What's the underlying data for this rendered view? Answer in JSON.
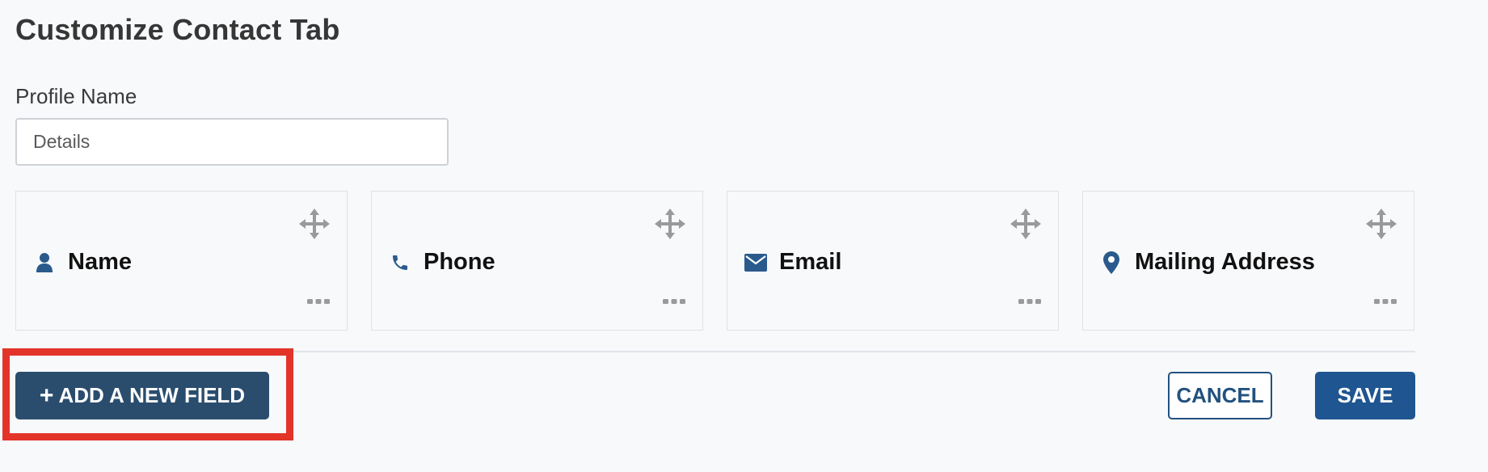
{
  "page": {
    "title": "Customize Contact Tab"
  },
  "profile": {
    "label": "Profile Name",
    "value": "Details"
  },
  "cards": [
    {
      "title": "Name",
      "icon": "user-icon"
    },
    {
      "title": "Phone",
      "icon": "phone-icon"
    },
    {
      "title": "Email",
      "icon": "envelope-icon"
    },
    {
      "title": "Mailing Address",
      "icon": "map-marker-icon"
    }
  ],
  "actions": {
    "add_label": "ADD A NEW FIELD",
    "add_icon": "plus-icon",
    "cancel_label": "CANCEL",
    "save_label": "SAVE"
  },
  "colors": {
    "accent": "#1f5590",
    "add_button": "#2a4d6e",
    "highlight": "#e3342a",
    "icon": "#2a5a8c",
    "handle": "#9a9a9a"
  }
}
